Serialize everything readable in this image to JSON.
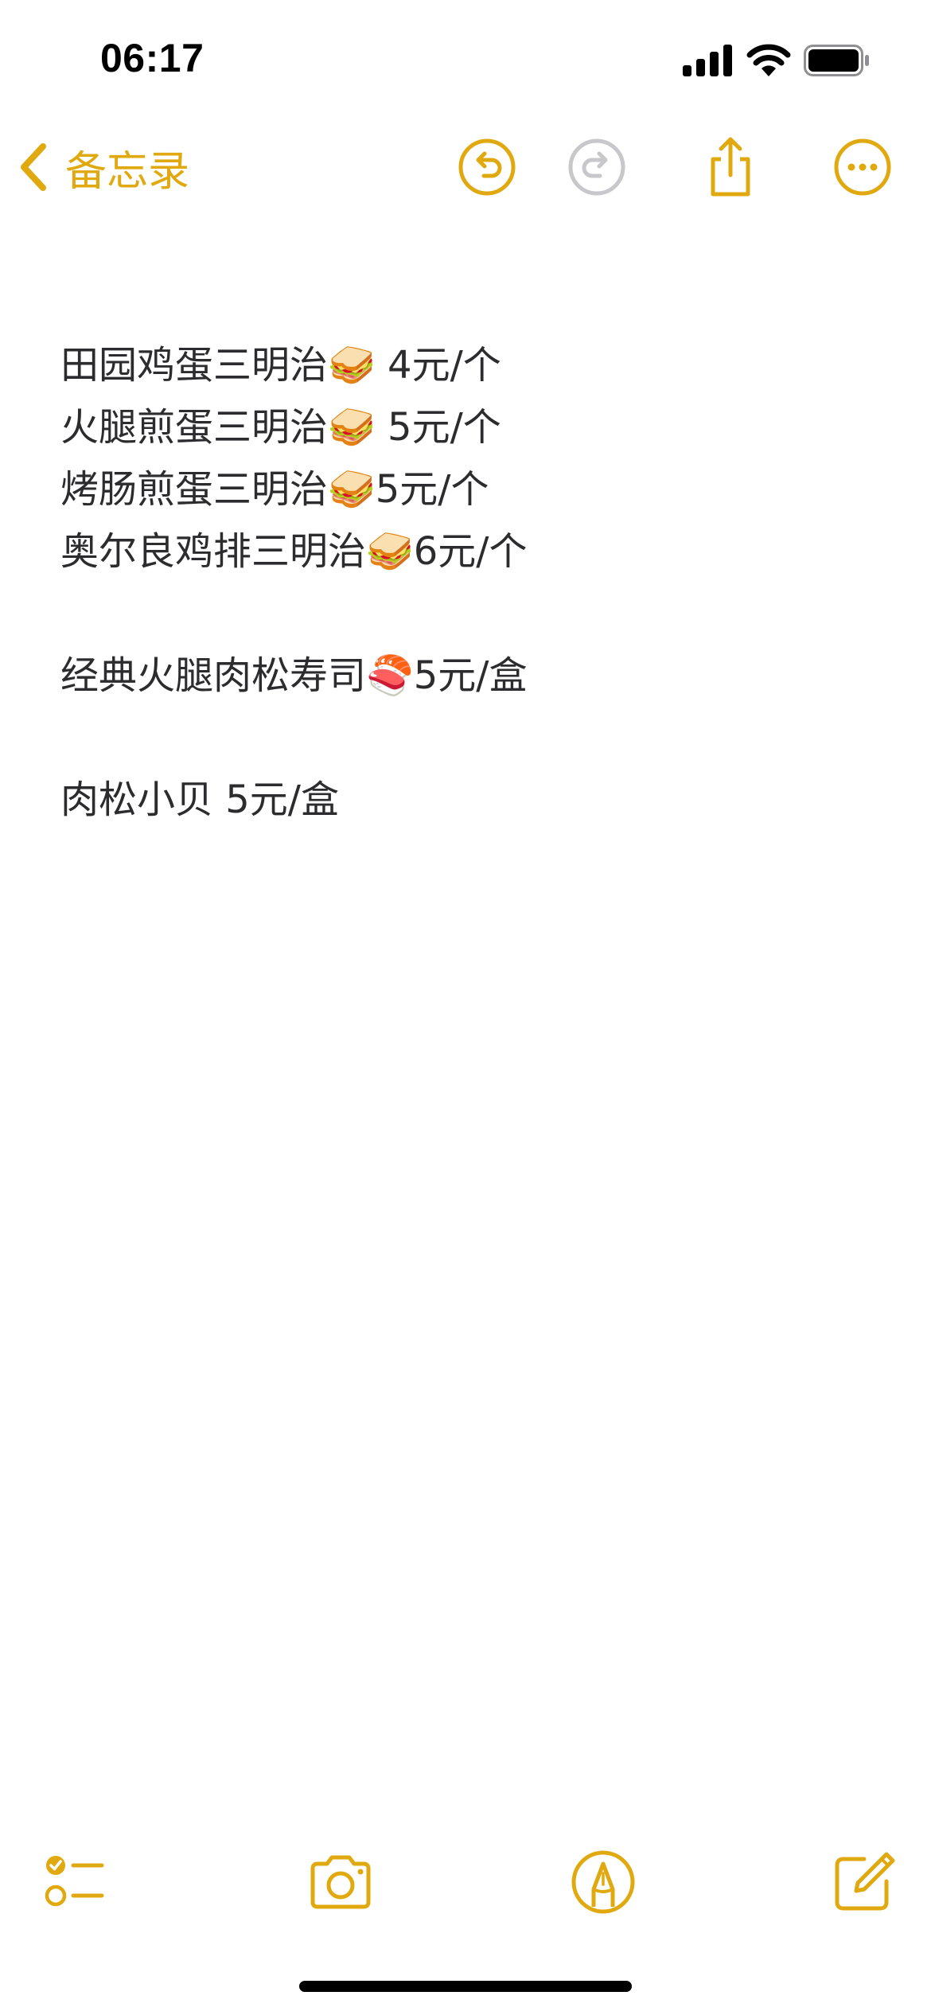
{
  "status_bar": {
    "time": "06:17"
  },
  "nav": {
    "back_label": "备忘录",
    "icons": [
      "chevron-left-icon",
      "undo-icon",
      "redo-icon",
      "share-icon",
      "more-icon"
    ]
  },
  "note": {
    "lines": [
      "田园鸡蛋三明治🥪 4元/个",
      "火腿煎蛋三明治🥪 5元/个",
      "烤肠煎蛋三明治🥪5元/个",
      "奥尔良鸡排三明治🥪6元/个",
      "",
      "经典火腿肉松寿司🍣5元/盒",
      "",
      "肉松小贝 5元/盒"
    ]
  },
  "toolbar": {
    "icons": [
      "checklist-icon",
      "camera-icon",
      "markup-icon",
      "compose-icon"
    ]
  },
  "colors": {
    "accent": "#e1a910",
    "disabled": "#c7c7cc",
    "text": "#2c2c2e",
    "background": "#ffffff"
  }
}
